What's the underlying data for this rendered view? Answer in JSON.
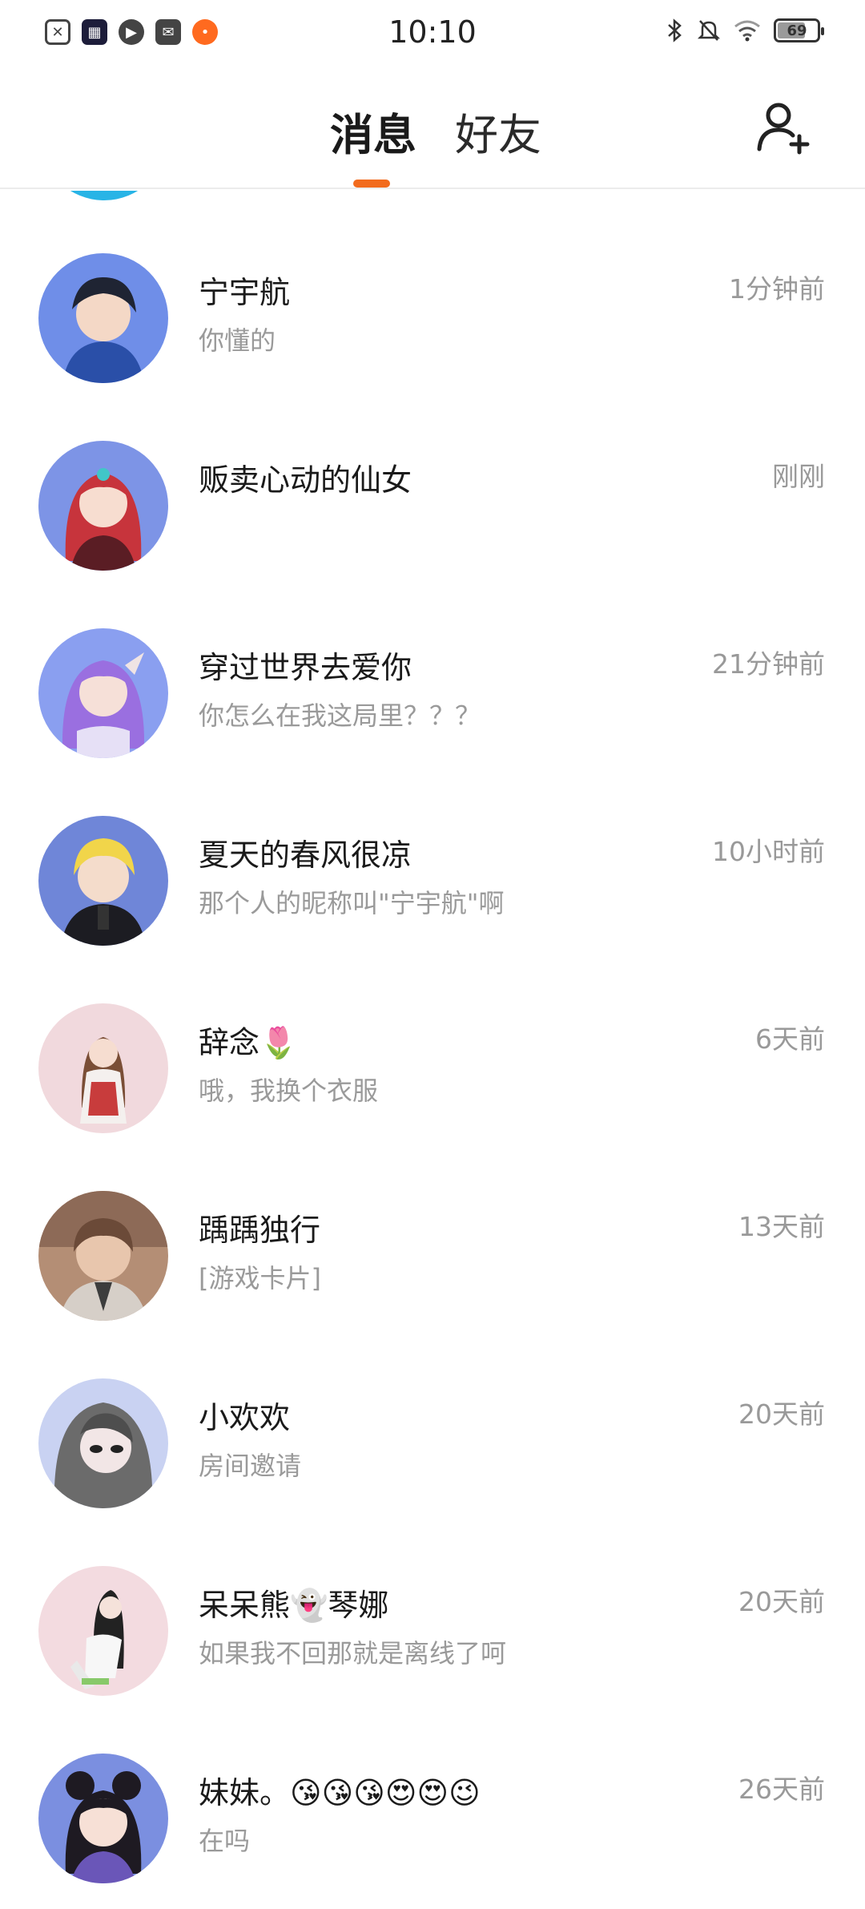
{
  "status_bar": {
    "time": "10:10",
    "battery": "69",
    "left_icons": [
      "sim-off-icon",
      "game-app-icon",
      "play-icon",
      "mail-icon",
      "pumpkin-icon"
    ],
    "right_icons": [
      "bluetooth-icon",
      "mute-icon",
      "wifi-icon",
      "battery-icon"
    ]
  },
  "header": {
    "tabs": [
      {
        "label": "消息",
        "active": true
      },
      {
        "label": "好友",
        "active": false
      }
    ],
    "add_friend_icon": "add-friend-icon",
    "accent_color": "#f26b1d"
  },
  "conversations": [
    {
      "name": "宁宇航",
      "time": "1分钟前",
      "preview": "你懂的",
      "avatar_color": "#6f8ee8"
    },
    {
      "name": "贩卖心动的仙女",
      "time": "刚刚",
      "preview": "",
      "avatar_color": "#7d94e6"
    },
    {
      "name": "穿过世界去爱你",
      "time": "21分钟前",
      "preview": "你怎么在我这局里？？？",
      "avatar_color": "#8a9ff0"
    },
    {
      "name": "夏天的春风很凉",
      "time": "10小时前",
      "preview": "那个人的昵称叫\"宁宇航\"啊",
      "avatar_color": "#6f86d8"
    },
    {
      "name": "辞念🌷",
      "time": "6天前",
      "preview": "哦，我换个衣服",
      "avatar_color": "#f1d9dd"
    },
    {
      "name": "踽踽独行",
      "time": "13天前",
      "preview": "[游戏卡片]",
      "avatar_color": "#b48e75"
    },
    {
      "name": "小欢欢",
      "time": "20天前",
      "preview": "房间邀请",
      "avatar_color": "#c9d2f2"
    },
    {
      "name": "呆呆熊👻琴娜",
      "time": "20天前",
      "preview": "如果我不回那就是离线了呵",
      "avatar_color": "#f3dbe0"
    },
    {
      "name": "妹妹。😘😘😘😍😍😉",
      "time": "26天前",
      "preview": "在吗",
      "avatar_color": "#7b8fe0"
    }
  ]
}
